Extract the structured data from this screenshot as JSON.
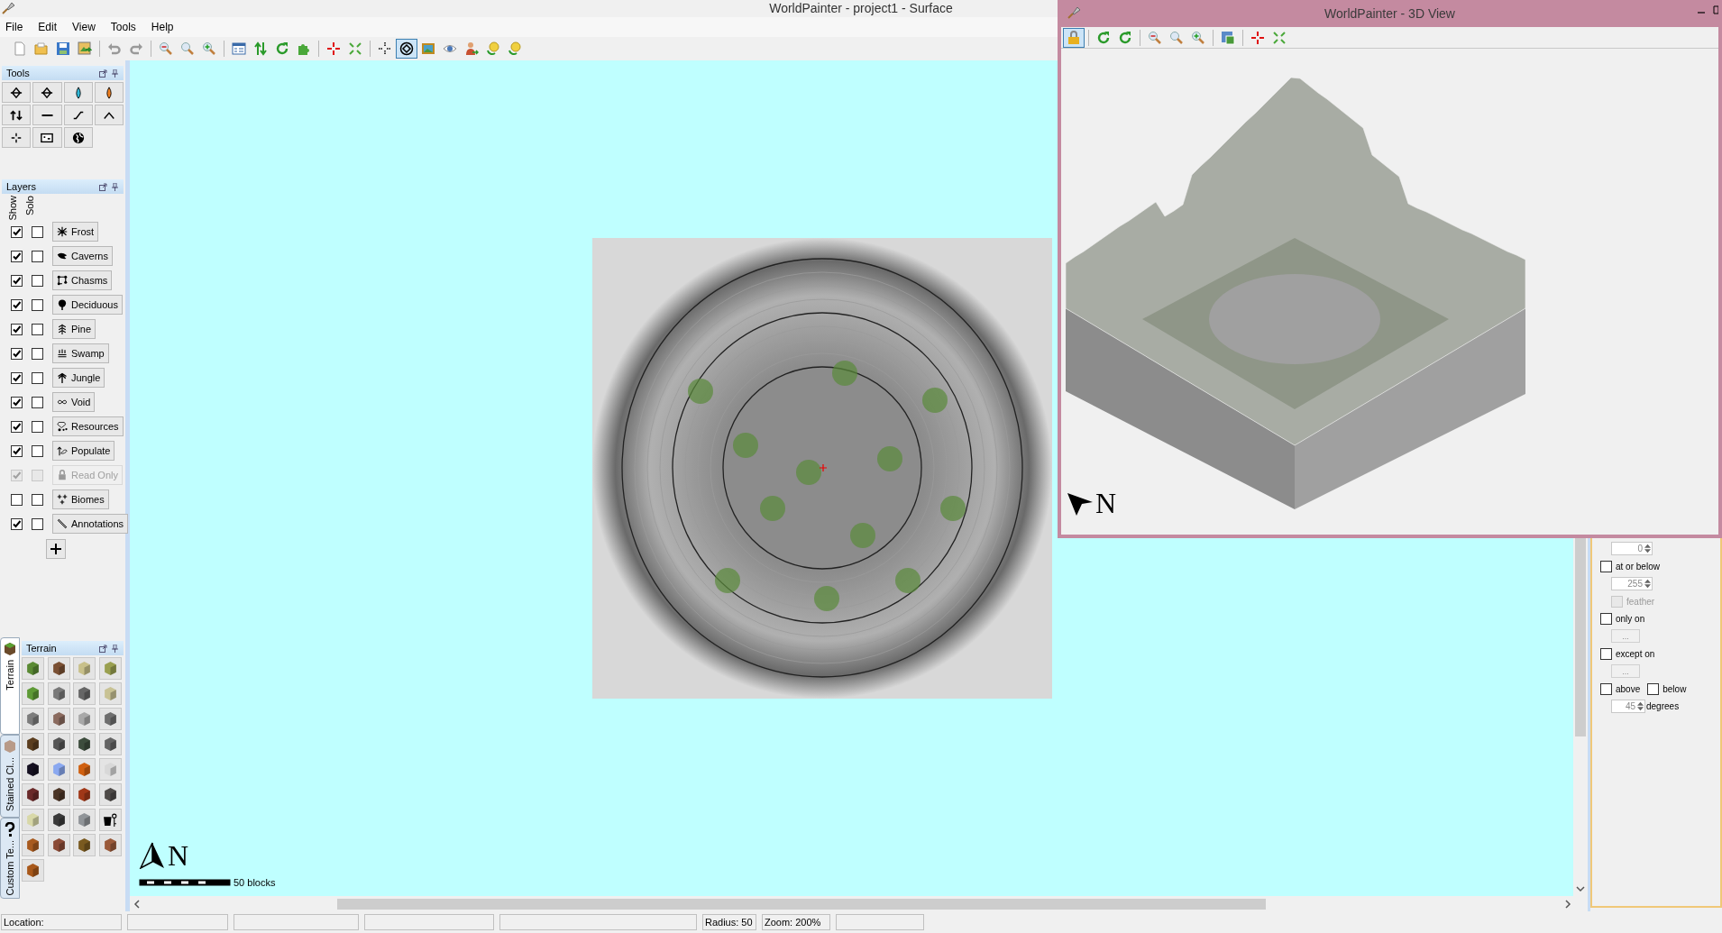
{
  "main_window": {
    "title": "WorldPainter - project1 - Surface"
  },
  "menu": [
    "File",
    "Edit",
    "View",
    "Tools",
    "Help"
  ],
  "toolbar": [
    [
      {
        "selected": false
      },
      {
        "selected": false
      },
      {
        "selected": false
      },
      {
        "selected": false
      }
    ],
    [
      {
        "selected": false
      },
      {
        "selected": false
      }
    ],
    [
      {
        "selected": false
      },
      {
        "selected": false
      },
      {
        "selected": false
      }
    ],
    [
      {
        "selected": false
      },
      {
        "selected": false
      },
      {
        "selected": false
      },
      {
        "selected": false
      }
    ],
    [
      {
        "selected": false
      },
      {
        "selected": false
      }
    ],
    [
      {
        "selected": false
      },
      {
        "selected": true
      },
      {
        "selected": false
      },
      {
        "selected": false
      },
      {
        "selected": false
      },
      {
        "selected": false
      },
      {
        "selected": false
      }
    ]
  ],
  "tools_panel": {
    "title": "Tools"
  },
  "layers_panel": {
    "title": "Layers",
    "show_heading": "Show",
    "solo_heading": "Solo",
    "layers": [
      {
        "label": "Frost",
        "show": true,
        "solo": false,
        "disabled": false
      },
      {
        "label": "Caverns",
        "show": true,
        "solo": false,
        "disabled": false
      },
      {
        "label": "Chasms",
        "show": true,
        "solo": false,
        "disabled": false
      },
      {
        "label": "Deciduous",
        "show": true,
        "solo": false,
        "disabled": false
      },
      {
        "label": "Pine",
        "show": true,
        "solo": false,
        "disabled": false
      },
      {
        "label": "Swamp",
        "show": true,
        "solo": false,
        "disabled": false
      },
      {
        "label": "Jungle",
        "show": true,
        "solo": false,
        "disabled": false
      },
      {
        "label": "Void",
        "show": true,
        "solo": false,
        "disabled": false
      },
      {
        "label": "Resources",
        "show": true,
        "solo": false,
        "disabled": false
      },
      {
        "label": "Populate",
        "show": true,
        "solo": false,
        "disabled": false
      },
      {
        "label": "Read Only",
        "show": true,
        "solo": false,
        "disabled": true
      },
      {
        "label": "Biomes",
        "show": false,
        "solo": false,
        "disabled": false
      },
      {
        "label": "Annotations",
        "show": true,
        "solo": false,
        "disabled": false
      }
    ]
  },
  "terrain_panel": {
    "title": "Terrain",
    "tabs": [
      {
        "label": "Terrain",
        "selected": true
      },
      {
        "label": "Stained Cl...",
        "selected": false
      },
      {
        "label": "Custom Te...",
        "selected": false
      }
    ],
    "tiles": [
      {
        "kind": "block",
        "color": "#5a8a34"
      },
      {
        "kind": "block",
        "color": "#7a5033"
      },
      {
        "kind": "block",
        "color": "#c8c08a"
      },
      {
        "kind": "block",
        "color": "#9aa050"
      },
      {
        "kind": "block",
        "color": "#5e9a36"
      },
      {
        "kind": "block",
        "color": "#787878"
      },
      {
        "kind": "block",
        "color": "#666666"
      },
      {
        "kind": "block",
        "color": "#c8c294"
      },
      {
        "kind": "block",
        "color": "#7c7c7c"
      },
      {
        "kind": "block",
        "color": "#8a6a5e"
      },
      {
        "kind": "block",
        "color": "#a8a8a8"
      },
      {
        "kind": "block",
        "color": "#6e6e6e"
      },
      {
        "kind": "block",
        "color": "#5b3d1e"
      },
      {
        "kind": "block",
        "color": "#555555"
      },
      {
        "kind": "block",
        "color": "#3d4d3d"
      },
      {
        "kind": "block",
        "color": "#646464"
      },
      {
        "kind": "block",
        "color": "#151020"
      },
      {
        "kind": "block",
        "color": "#8aa8f0"
      },
      {
        "kind": "block",
        "color": "#d06010"
      },
      {
        "kind": "block",
        "color": "#d8d8d8"
      },
      {
        "kind": "block",
        "color": "#6a2a2a"
      },
      {
        "kind": "block",
        "color": "#4a3426"
      },
      {
        "kind": "block",
        "color": "#a03818"
      },
      {
        "kind": "block",
        "color": "#4e4a48"
      },
      {
        "kind": "block",
        "color": "#d8d8a8"
      },
      {
        "kind": "block",
        "color": "#3a3a3a"
      },
      {
        "kind": "block",
        "color": "#909498"
      },
      {
        "kind": "custom",
        "color": "#000000"
      },
      {
        "kind": "block",
        "color": "#a85a1e"
      },
      {
        "kind": "block",
        "color": "#8a4a36"
      },
      {
        "kind": "block",
        "color": "#7a5a20"
      },
      {
        "kind": "block",
        "color": "#9a5a3a"
      },
      {
        "kind": "block",
        "color": "#a8581a"
      }
    ]
  },
  "canvas": {
    "compass": "N",
    "scale_label": "50 blocks"
  },
  "side_panel": {
    "min_value": "0",
    "at_or_below": {
      "label": "at or below",
      "checked": false
    },
    "max_value": "255",
    "feather": {
      "label": "feather",
      "checked": false,
      "disabled": true
    },
    "only_on": {
      "label": "only on",
      "checked": false
    },
    "only_on_button": "...",
    "except_on": {
      "label": "except on",
      "checked": false
    },
    "except_on_button": "...",
    "above": {
      "label": "above",
      "checked": false
    },
    "below": {
      "label": "below",
      "checked": false
    },
    "degrees_value": "45",
    "degrees_label": "degrees"
  },
  "status_bar": {
    "location": "Location:",
    "radius": "Radius: 50",
    "zoom": "Zoom: 200%"
  },
  "view3d": {
    "title": "WorldPainter - 3D View",
    "toolbar": [
      [
        {
          "selected": true
        }
      ],
      [
        {
          "selected": false
        },
        {
          "selected": false
        }
      ],
      [
        {
          "selected": false
        },
        {
          "selected": false
        },
        {
          "selected": false
        }
      ],
      [
        {
          "selected": false
        }
      ],
      [
        {
          "selected": false
        },
        {
          "selected": false
        }
      ]
    ],
    "compass": "N"
  }
}
